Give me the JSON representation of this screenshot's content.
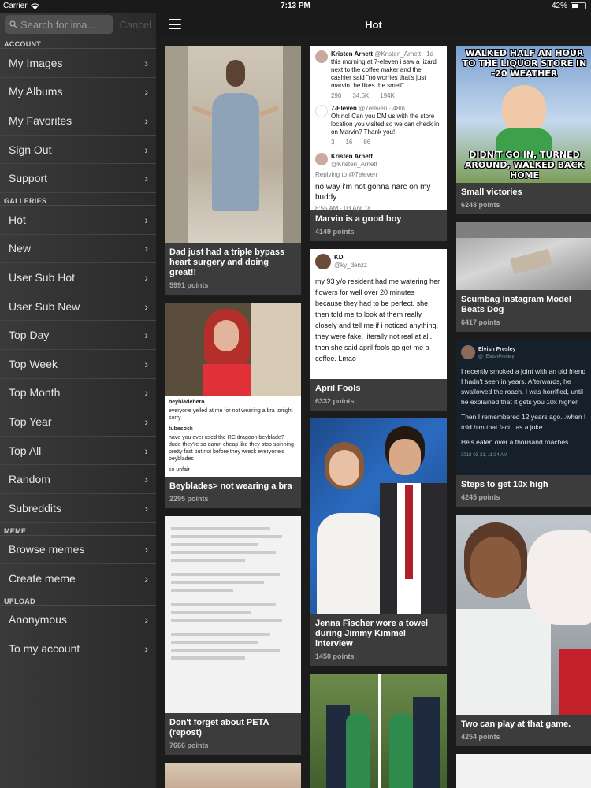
{
  "status": {
    "carrier": "Carrier",
    "time": "7:13 PM",
    "battery": "42%"
  },
  "sidebar": {
    "search_placeholder": "Search for ima...",
    "cancel": "Cancel",
    "sections": {
      "account": "ACCOUNT",
      "galleries": "GALLERIES",
      "meme": "MEME",
      "upload": "UPLOAD"
    },
    "account_items": [
      "My Images",
      "My Albums",
      "My Favorites",
      "Sign Out",
      "Support"
    ],
    "gallery_items": [
      "Hot",
      "New",
      "User Sub Hot",
      "User Sub New",
      "Top Day",
      "Top Week",
      "Top Month",
      "Top Year",
      "Top All",
      "Random",
      "Subreddits"
    ],
    "meme_items": [
      "Browse memes",
      "Create meme"
    ],
    "upload_items": [
      "Anonymous",
      "To my account"
    ]
  },
  "header": {
    "title": "Hot"
  },
  "cards": {
    "c1": {
      "title": "Dad just had a triple bypass heart surgery and doing great!!",
      "points": "5991 points"
    },
    "c2": {
      "title": "Beyblades> not wearing a bra",
      "points": "2295 points",
      "tumblr1_user": "beybladehero",
      "tumblr1_text": "everyone yelled at me for not wearing a bra tonight sorry",
      "tumblr2_user": "tubesock",
      "tumblr2_text": "have you ever used the RC dragoon beyblade? dude they're so damn cheap like they stop spinning pretty fast but not before they wreck everyone's beyblades",
      "tumblr3_text": "so unfair"
    },
    "c3": {
      "title": "Don't forget about PETA (repost)",
      "points": "7666 points"
    },
    "c4": {
      "title": "Marvin is a good boy",
      "points": "4149 points",
      "t1_name": "Kristen Arnett",
      "t1_handle": "@Kristen_Arnett · 1d",
      "t1_text": "this morning at 7-eleven i saw a lizard next to the coffee maker and the cashier said \"no worries that's just marvin, he likes the smell\"",
      "t1_stats": [
        "290",
        "34.6K",
        "194K"
      ],
      "t2_name": "7-Eleven",
      "t2_handle": "@7eleven · 48m",
      "t2_text": "Oh no! Can you DM us with the store location you visited so we can check in on Marvin? Thank you!",
      "t2_stats": [
        "3",
        "16",
        "86"
      ],
      "t3_name": "Kristen Arnett",
      "t3_handle": "@Kristen_Arnett",
      "t3_reply": "Replying to @7eleven",
      "t3_text": "no way i'm not gonna narc on my buddy",
      "t3_time": "8:55 AM · 03 Apr 18"
    },
    "c5": {
      "title": "April Fools",
      "points": "6332 points",
      "name": "KD",
      "handle": "@ky_denzz",
      "text": "my 93 y/o resident had me watering her flowers for well over 20 minutes because they had to be perfect. she then told me to look at them really closely and tell me if i noticed anything. they were fake, literally not real at all. then she said april fools go get me a coffee. Lmao"
    },
    "c6": {
      "title": "Jenna Fischer wore a towel during Jimmy Kimmel interview",
      "points": "1450 points"
    },
    "c7": {
      "title": "Small victories",
      "points": "6248 points",
      "top_text": "WALKED HALF AN HOUR TO THE LIQUOR STORE IN -20 WEATHER",
      "bottom_text": "DIDN'T GO IN, TURNED AROUND, WALKED BACK HOME"
    },
    "c8": {
      "title": "Scumbag Instagram Model Beats Dog",
      "points": "6417 points"
    },
    "c9": {
      "title": "Steps to get 10x high",
      "points": "4245 points",
      "name": "Elvish Presley",
      "handle": "@_ElvishPresley_",
      "p1": "I recently smoked a joint with an old friend I hadn't seen in years. Afterwards, he swallowed the roach. I was horrified, until he explained that it gets you 10x higher.",
      "p2": "Then I remembered 12 years ago...when I told him that fact...as a joke.",
      "p3": "He's eaten over a thousand roaches.",
      "time": "2018-03-31, 11:34 AM"
    },
    "c10": {
      "title": "Two can play at that game.",
      "points": "4254 points"
    }
  }
}
